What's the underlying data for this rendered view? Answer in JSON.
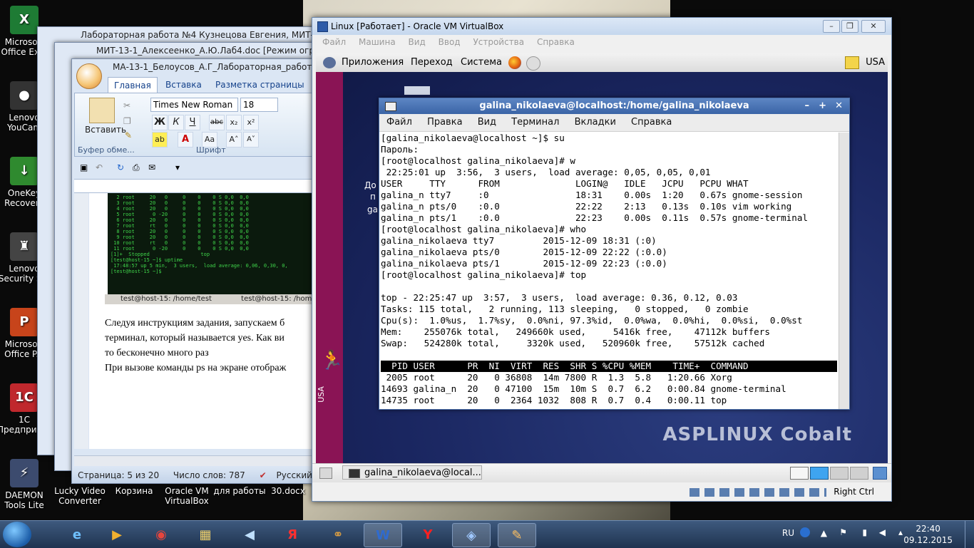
{
  "desktop": {
    "icons": [
      {
        "label": "Microsoft Office Ex...",
        "color": "#1e7b34",
        "glyph": "X"
      },
      {
        "label": "Lenovo YouCam",
        "color": "#333333",
        "glyph": "●"
      },
      {
        "label": "OneKey Recovery",
        "color": "#2f8a2f",
        "glyph": "↓"
      },
      {
        "label": "Lenovo Security S...",
        "color": "#444444",
        "glyph": "♜"
      },
      {
        "label": "Microsoft Office P...",
        "color": "#c7441b",
        "glyph": "P"
      },
      {
        "label": "1C Предприятие",
        "color": "#c0282d",
        "glyph": "1C"
      },
      {
        "label": "DAEMON Tools Lite",
        "color": "#3c4b6e",
        "glyph": "⚡"
      }
    ],
    "bottom_icons": [
      "Lucky Video Converter",
      "Корзина",
      "Oracle VM VirtualBox",
      "для работы",
      "30.docx"
    ]
  },
  "word_windows": {
    "back1_title": "Лабораторная работа №4 Кузнецова Евгения, МИТ-13-1.doc",
    "back2_title": "МИТ-13-1_Алексеенко_А.Ю.Лаб4.doc [Режим ограниченной функциональности]",
    "front_title": "МА-13-1_Белоусов_А.Г_Лабораторная_работа_N4.doc",
    "tabs": [
      "Главная",
      "Вставка",
      "Разметка страницы"
    ],
    "paste_label": "Вставить",
    "font_name": "Times New Roman",
    "font_size": "18",
    "clipboard_group": "Буфер обме...",
    "font_group": "Шрифт",
    "term_tab_1": "test@host-15: /home/test",
    "term_tab_2": "test@host-15: /home/test",
    "term_preview": "  2 root     20   0     0    0    0 S 0,0  0,0\n  3 root     20   0     0    0    0 S 0,0  0,0\n  4 root     20   0     0    0    0 S 0,0  0,0\n  5 root      0 -20     0    0    0 S 0,0  0,0\n  6 root     20   0     0    0    0 S 0,0  0,0\n  7 root     rt   0     0    0    0 S 0,0  0,0\n  8 root     20   0     0    0    0 S 0,0  0,0\n  9 root     20   0     0    0    0 S 0,0  0,0\n 10 root     rt   0     0    0    0 S 0,0  0,0\n 11 root      0 -20     0    0    0 S 0,0  0,0\n[1]+  Stopped                 top\n[test@host-15 ~]$ uptime\n 17:48:57 up 5 min,  3 users,  load average: 0,06, 0,30, 0,\n[test@host-15 ~]$ ",
    "doc_line1": "Следуя инструкциям задания, запускаем б",
    "doc_line2": "терминал, который называется yes. Как ви",
    "doc_line3": "то бесконечно много раз",
    "doc_line4": "При вызове команды ps на экране отображ",
    "status_page": "Страница: 5 из 20",
    "status_words": "Число слов: 787",
    "status_lang": "Русский (Россия"
  },
  "vbox": {
    "title": "Linux [Работает] - Oracle VM VirtualBox",
    "menu": [
      "Файл",
      "Машина",
      "Вид",
      "Ввод",
      "Устройства",
      "Справка"
    ],
    "gnome_menu": [
      "Приложения",
      "Переход",
      "Система"
    ],
    "keyboard": "USA",
    "side_label": "USA",
    "brand": "ASPLINUX Cobalt",
    "task_button": "galina_nikolaeva@local...",
    "host_key": "Right Ctrl",
    "desktop_text_1": "До",
    "desktop_text_2": "п",
    "desktop_text_3": "ga"
  },
  "terminal": {
    "title": "galina_nikolaeva@localhost:/home/galina_nikolaeva",
    "menu": [
      "Файл",
      "Правка",
      "Вид",
      "Терминал",
      "Вкладки",
      "Справка"
    ],
    "lines": [
      "[galina_nikolaeva@localhost ~]$ su",
      "Пароль:",
      "[root@localhost galina_nikolaeva]# w",
      " 22:25:01 up  3:56,  3 users,  load average: 0,05, 0,05, 0,01",
      "USER     TTY      FROM              LOGIN@   IDLE   JCPU   PCPU WHAT",
      "galina_n tty7     :0                18:31    0.00s  1:20   0.67s gnome-session",
      "galina_n pts/0    :0.0              22:22    2:13   0.13s  0.10s vim working",
      "galina_n pts/1    :0.0              22:23    0.00s  0.11s  0.57s gnome-terminal",
      "[root@localhost galina_nikolaeva]# who",
      "galina_nikolaeva tty7         2015-12-09 18:31 (:0)",
      "galina_nikolaeva pts/0        2015-12-09 22:22 (:0.0)",
      "galina_nikolaeva pts/1        2015-12-09 22:23 (:0.0)",
      "[root@localhost galina_nikolaeva]# top",
      "",
      "top - 22:25:47 up  3:57,  3 users,  load average: 0.36, 0.12, 0.03",
      "Tasks: 115 total,   2 running, 113 sleeping,   0 stopped,   0 zombie",
      "Cpu(s):  1.0%us,  1.7%sy,  0.0%ni, 97.3%id,  0.0%wa,  0.0%hi,  0.0%si,  0.0%st",
      "Mem:    255076k total,   249660k used,     5416k free,    47112k buffers",
      "Swap:   524280k total,     3320k used,   520960k free,    57512k cached",
      ""
    ],
    "top_header": "  PID USER      PR  NI  VIRT  RES  SHR S %CPU %MEM    TIME+  COMMAND",
    "top_rows": [
      " 2005 root      20   0 36808  14m 7800 R  1.3  5.8   1:20.66 Xorg",
      "14693 galina_n  20   0 47100  15m  10m S  0.7  6.2   0:00.84 gnome-terminal",
      "14735 root      20   0  2364 1032  808 R  0.7  0.4   0:00.11 top"
    ]
  },
  "taskbar": {
    "lang": "RU",
    "time": "22:40",
    "date": "09.12.2015"
  }
}
